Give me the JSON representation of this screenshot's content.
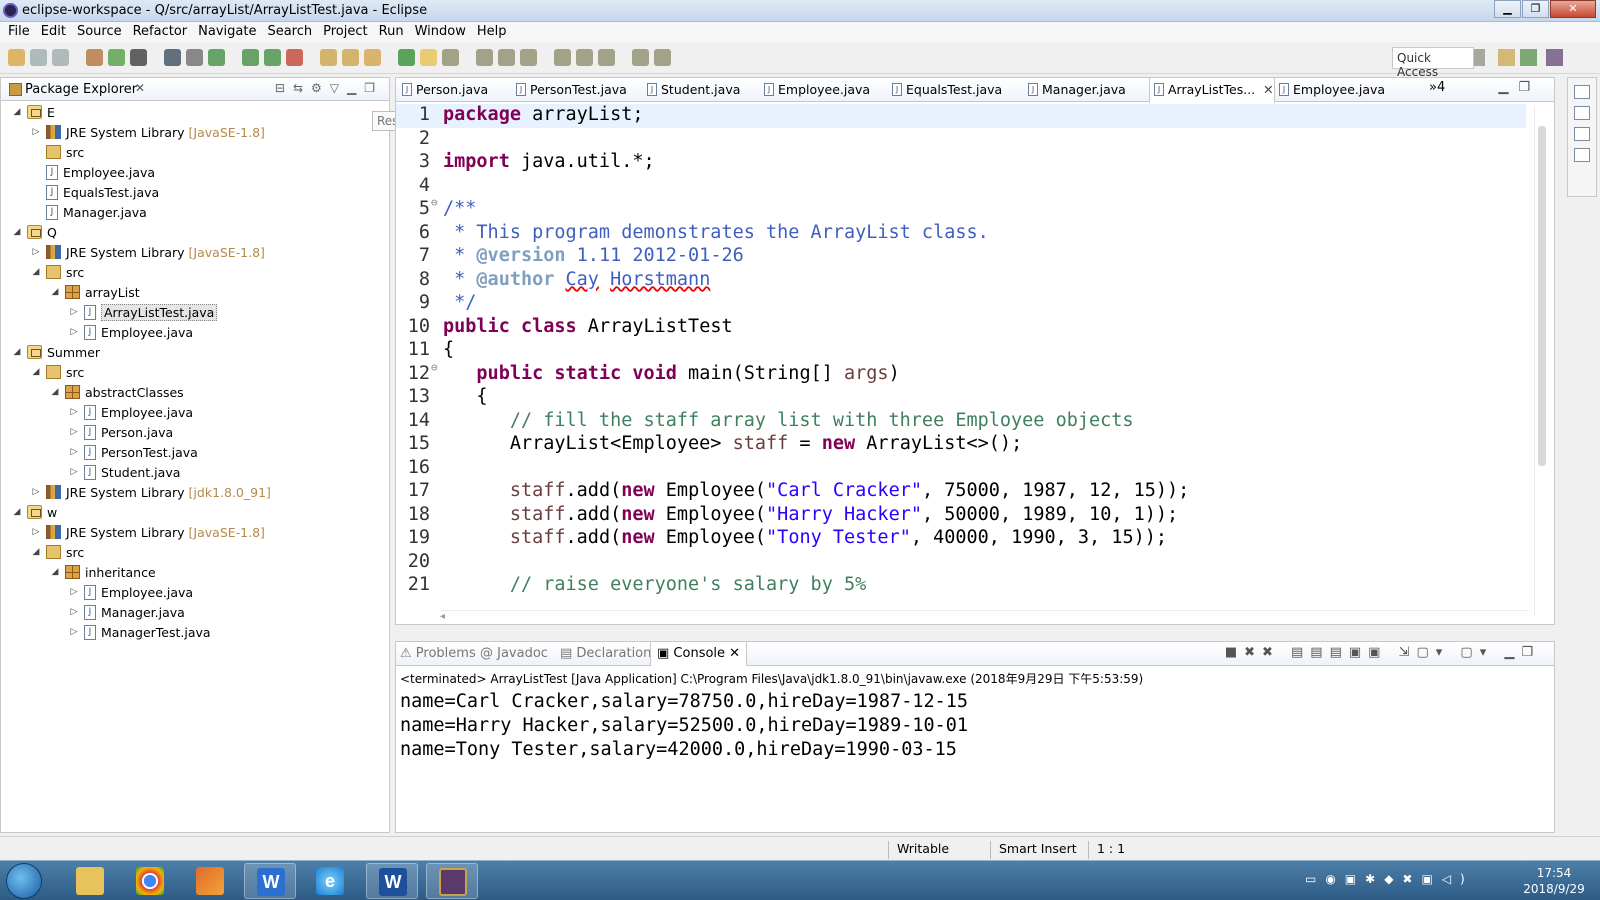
{
  "window": {
    "title": "eclipse-workspace - Q/src/arrayList/ArrayListTest.java - Eclipse"
  },
  "menu": [
    "File",
    "Edit",
    "Source",
    "Refactor",
    "Navigate",
    "Search",
    "Project",
    "Run",
    "Window",
    "Help"
  ],
  "toolbar": {
    "quick_access": "Quick Access"
  },
  "package_explorer": {
    "title": "Package Explorer",
    "tooltip": "Restore",
    "items": [
      {
        "label": "E",
        "decor": "",
        "depth": 0,
        "twisty": "◢",
        "icon": "proj"
      },
      {
        "label": "JRE System Library",
        "decor": "[JavaSE-1.8]",
        "depth": 1,
        "twisty": "▷",
        "icon": "lib"
      },
      {
        "label": "src",
        "decor": "",
        "depth": 1,
        "twisty": "",
        "icon": "src"
      },
      {
        "label": "Employee.java",
        "decor": "",
        "depth": 1,
        "twisty": "",
        "icon": "java"
      },
      {
        "label": "EqualsTest.java",
        "decor": "",
        "depth": 1,
        "twisty": "",
        "icon": "java"
      },
      {
        "label": "Manager.java",
        "decor": "",
        "depth": 1,
        "twisty": "",
        "icon": "java"
      },
      {
        "label": "Q",
        "decor": "",
        "depth": 0,
        "twisty": "◢",
        "icon": "proj"
      },
      {
        "label": "JRE System Library",
        "decor": "[JavaSE-1.8]",
        "depth": 1,
        "twisty": "▷",
        "icon": "lib"
      },
      {
        "label": "src",
        "decor": "",
        "depth": 1,
        "twisty": "◢",
        "icon": "src"
      },
      {
        "label": "arrayList",
        "decor": "",
        "depth": 2,
        "twisty": "◢",
        "icon": "pkg"
      },
      {
        "label": "ArrayListTest.java",
        "decor": "",
        "depth": 3,
        "twisty": "▷",
        "icon": "java",
        "selected": true
      },
      {
        "label": "Employee.java",
        "decor": "",
        "depth": 3,
        "twisty": "▷",
        "icon": "java"
      },
      {
        "label": "Summer",
        "decor": "",
        "depth": 0,
        "twisty": "◢",
        "icon": "proj"
      },
      {
        "label": "src",
        "decor": "",
        "depth": 1,
        "twisty": "◢",
        "icon": "src"
      },
      {
        "label": "abstractClasses",
        "decor": "",
        "depth": 2,
        "twisty": "◢",
        "icon": "pkg"
      },
      {
        "label": "Employee.java",
        "decor": "",
        "depth": 3,
        "twisty": "▷",
        "icon": "java"
      },
      {
        "label": "Person.java",
        "decor": "",
        "depth": 3,
        "twisty": "▷",
        "icon": "java"
      },
      {
        "label": "PersonTest.java",
        "decor": "",
        "depth": 3,
        "twisty": "▷",
        "icon": "java"
      },
      {
        "label": "Student.java",
        "decor": "",
        "depth": 3,
        "twisty": "▷",
        "icon": "java"
      },
      {
        "label": "JRE System Library",
        "decor": "[jdk1.8.0_91]",
        "depth": 1,
        "twisty": "▷",
        "icon": "lib"
      },
      {
        "label": "w",
        "decor": "",
        "depth": 0,
        "twisty": "◢",
        "icon": "proj"
      },
      {
        "label": "JRE System Library",
        "decor": "[JavaSE-1.8]",
        "depth": 1,
        "twisty": "▷",
        "icon": "lib"
      },
      {
        "label": "src",
        "decor": "",
        "depth": 1,
        "twisty": "◢",
        "icon": "src"
      },
      {
        "label": "inheritance",
        "decor": "",
        "depth": 2,
        "twisty": "◢",
        "icon": "pkg"
      },
      {
        "label": "Employee.java",
        "decor": "",
        "depth": 3,
        "twisty": "▷",
        "icon": "java"
      },
      {
        "label": "Manager.java",
        "decor": "",
        "depth": 3,
        "twisty": "▷",
        "icon": "java"
      },
      {
        "label": "ManagerTest.java",
        "decor": "",
        "depth": 3,
        "twisty": "▷",
        "icon": "java"
      }
    ]
  },
  "editor": {
    "tabs": [
      {
        "label": "Person.java"
      },
      {
        "label": "PersonTest.java"
      },
      {
        "label": "Student.java"
      },
      {
        "label": "Employee.java"
      },
      {
        "label": "EqualsTest.java"
      },
      {
        "label": "Manager.java"
      },
      {
        "label": "ArrayListTes...",
        "active": true
      },
      {
        "label": "Employee.java"
      }
    ],
    "more_tabs": "»4",
    "lines": [
      {
        "n": "1",
        "html": "<span class=\"k\">package</span> arrayList;"
      },
      {
        "n": "2",
        "html": ""
      },
      {
        "n": "3",
        "html": "<span class=\"k\">import</span> java.util.*;"
      },
      {
        "n": "4",
        "html": ""
      },
      {
        "n": "5",
        "html": "<span class=\"cm\">/**</span>",
        "fold": "⊖"
      },
      {
        "n": "6",
        "html": "<span class=\"cm\"> * This program demonstrates the ArrayList class.</span>"
      },
      {
        "n": "7",
        "html": "<span class=\"cm\"> * </span><span class=\"tg\">@version</span><span class=\"cm\"> 1.11 2012-01-26</span>"
      },
      {
        "n": "8",
        "html": "<span class=\"cm\"> * </span><span class=\"tg\">@author</span><span class=\"cm\"> <span class=\"sp\">Cay</span> <span class=\"sp\">Horstmann</span></span>"
      },
      {
        "n": "9",
        "html": "<span class=\"cm\"> */</span>"
      },
      {
        "n": "10",
        "html": "<span class=\"k\">public</span> <span class=\"k\">class</span> ArrayListTest"
      },
      {
        "n": "11",
        "html": "{"
      },
      {
        "n": "12",
        "html": "   <span class=\"k\">public</span> <span class=\"k\">static</span> <span class=\"k\">void</span> main(String[] <span class=\"fd\" style=\"color:#6a3e3e\">args</span>)",
        "fold": "⊖"
      },
      {
        "n": "13",
        "html": "   {"
      },
      {
        "n": "14",
        "html": "      <span class=\"lc\">// fill the staff array list with three Employee objects</span>"
      },
      {
        "n": "15",
        "html": "      ArrayList&lt;Employee&gt; <span style=\"color:#6a3e3e\">staff</span> = <span class=\"k\">new</span> ArrayList&lt;&gt;();"
      },
      {
        "n": "16",
        "html": ""
      },
      {
        "n": "17",
        "html": "      <span style=\"color:#6a3e3e\">staff</span>.add(<span class=\"k\">new</span> Employee(<span class=\"st\">\"Carl Cracker\"</span>, 75000, 1987, 12, 15));"
      },
      {
        "n": "18",
        "html": "      <span style=\"color:#6a3e3e\">staff</span>.add(<span class=\"k\">new</span> Employee(<span class=\"st\">\"Harry Hacker\"</span>, 50000, 1989, 10, 1));"
      },
      {
        "n": "19",
        "html": "      <span style=\"color:#6a3e3e\">staff</span>.add(<span class=\"k\">new</span> Employee(<span class=\"st\">\"Tony Tester\"</span>, 40000, 1990, 3, 15));"
      },
      {
        "n": "20",
        "html": ""
      },
      {
        "n": "21",
        "html": "      <span class=\"lc\">// raise everyone's salary by 5%</span>"
      }
    ]
  },
  "console": {
    "tabs": [
      {
        "label": "Problems"
      },
      {
        "label": "@ Javadoc"
      },
      {
        "label": "Declaration"
      },
      {
        "label": "Console",
        "active": true
      }
    ],
    "status": "<terminated> ArrayListTest [Java Application] C:\\Program Files\\Java\\jdk1.8.0_91\\bin\\javaw.exe (2018年9月29日 下午5:53:59)",
    "output": [
      "name=Carl Cracker,salary=78750.0,hireDay=1987-12-15",
      "name=Harry Hacker,salary=52500.0,hireDay=1989-10-01",
      "name=Tony Tester,salary=42000.0,hireDay=1990-03-15"
    ]
  },
  "statusbar": {
    "writable": "Writable",
    "insert_mode": "Smart Insert",
    "position": "1 : 1"
  },
  "taskbar": {
    "time": "17:54",
    "date": "2018/9/29"
  }
}
